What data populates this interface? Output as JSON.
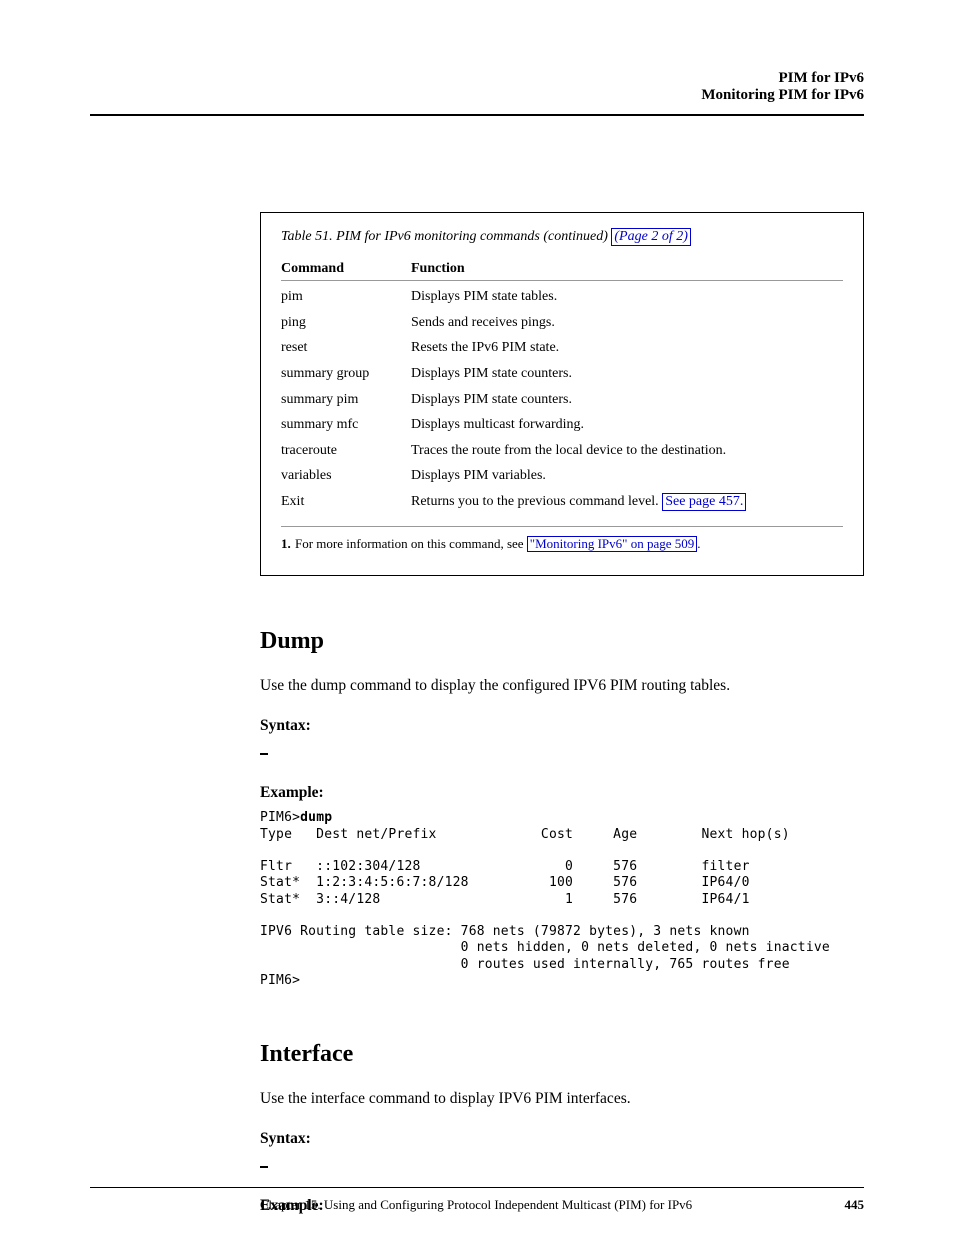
{
  "header": {
    "line1": "PIM for IPv6",
    "line2": "Monitoring PIM for IPv6"
  },
  "table": {
    "caption_prefix": "Table 51. PIM for IPv6 monitoring commands (continued)",
    "caption_link": "(Page 2 of 2)",
    "head_command": "Command",
    "head_function": "Function",
    "rows": [
      {
        "cmd": "pim",
        "fn": "Displays PIM state tables."
      },
      {
        "cmd": "ping",
        "fn": "Sends and receives pings."
      },
      {
        "cmd": "reset",
        "fn": "Resets the IPv6 PIM state."
      },
      {
        "cmd": "summary group",
        "fn": "Displays PIM state counters."
      },
      {
        "cmd": "summary pim",
        "fn": "Displays PIM state counters."
      },
      {
        "cmd": "summary mfc",
        "fn": "Displays multicast forwarding."
      },
      {
        "cmd": "traceroute",
        "fn": "Traces the route from the local device to the destination."
      },
      {
        "cmd": "variables",
        "fn": "Displays PIM variables."
      },
      {
        "cmd": "Exit",
        "fn": "Returns you to the previous command level."
      }
    ],
    "footnote_pageref": "See page 457.",
    "footnote_num": "1.",
    "footnote_prefix": "For more information on this command, see ",
    "footnote_linktext": "\"Monitoring IPv6\" on page 509",
    "footnote_suffix": "."
  },
  "dump_section": {
    "title": "Dump",
    "para": "Use the dump command to display the configured IPV6 PIM routing tables.",
    "syntax_label": "Syntax:",
    "example_label": "Example:",
    "example": {
      "prompt": "PIM6>",
      "cmd": "dump",
      "header": "Type   Dest net/Prefix             Cost     Age        Next hop(s)",
      "lines": [
        "Fltr   ::102:304/128                  0     576        filter",
        "Stat*  1:2:3:4:5:6:7:8/128          100     576        IP64/0",
        "Stat*  3::4/128                       1     576        IP64/1"
      ],
      "foot1": "IPV6 Routing table size: 768 nets (79872 bytes), 3 nets known",
      "foot2": "                         0 nets hidden, 0 nets deleted, 0 nets inactive",
      "foot3": "                         0 routes used internally, 765 routes free",
      "endprompt": "PIM6>"
    }
  },
  "interface_section": {
    "title": "Interface",
    "para": "Use the interface command to display IPV6 PIM interfaces.",
    "syntax_label": "Syntax:",
    "example_label": "Example:"
  },
  "footer": {
    "left": "Chapter 15. Using and Configuring Protocol Independent Multicast (PIM) for IPv6",
    "right": "445"
  }
}
